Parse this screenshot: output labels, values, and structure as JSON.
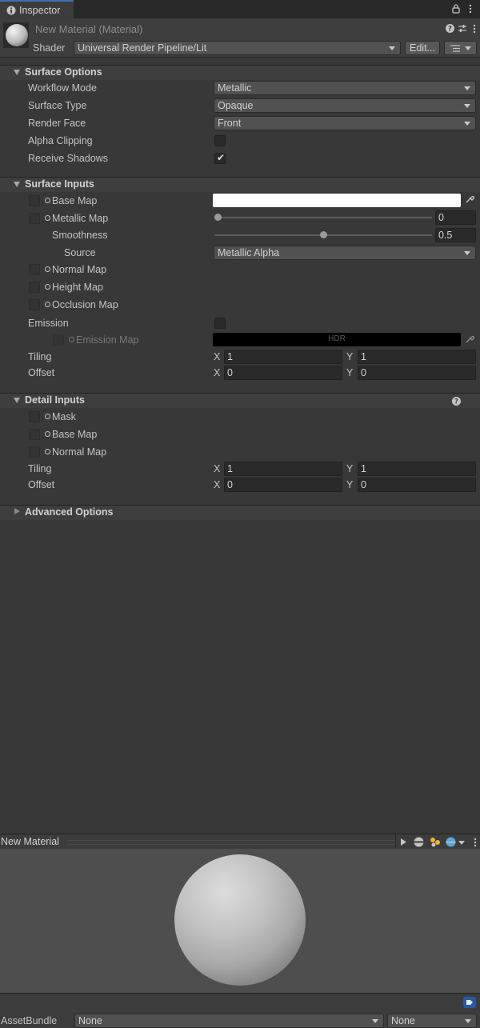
{
  "tab": {
    "title": "Inspector",
    "icon": "info-icon"
  },
  "header": {
    "title": "New Material (Material)",
    "shader_label": "Shader",
    "shader_value": "Universal Render Pipeline/Lit",
    "edit_button": "Edit..."
  },
  "surface_options": {
    "title": "Surface Options",
    "workflow_label": "Workflow Mode",
    "workflow_value": "Metallic",
    "surface_type_label": "Surface Type",
    "surface_type_value": "Opaque",
    "render_face_label": "Render Face",
    "render_face_value": "Front",
    "alpha_clipping_label": "Alpha Clipping",
    "alpha_clipping": false,
    "receive_shadows_label": "Receive Shadows",
    "receive_shadows": true
  },
  "surface_inputs": {
    "title": "Surface Inputs",
    "base_map_label": "Base Map",
    "base_map_color": "#ffffff",
    "metallic_map_label": "Metallic Map",
    "metallic_value": "0",
    "metallic": 0,
    "smoothness_label": "Smoothness",
    "smoothness_value": "0.5",
    "smoothness": 0.5,
    "source_label": "Source",
    "source_value": "Metallic Alpha",
    "normal_map_label": "Normal Map",
    "height_map_label": "Height Map",
    "occlusion_map_label": "Occlusion Map",
    "emission_label": "Emission",
    "emission_map_label": "Emission Map",
    "emission_hdr": "HDR",
    "tiling_label": "Tiling",
    "tiling_x": "1",
    "tiling_y": "1",
    "offset_label": "Offset",
    "offset_x": "0",
    "offset_y": "0",
    "x_label": "X",
    "y_label": "Y"
  },
  "detail_inputs": {
    "title": "Detail Inputs",
    "mask_label": "Mask",
    "base_map_label": "Base Map",
    "normal_map_label": "Normal Map",
    "tiling_label": "Tiling",
    "tiling_x": "1",
    "tiling_y": "1",
    "offset_label": "Offset",
    "offset_x": "0",
    "offset_y": "0",
    "x_label": "X",
    "y_label": "Y"
  },
  "advanced_options": {
    "title": "Advanced Options"
  },
  "preview": {
    "title": "New Material"
  },
  "asset_bundle": {
    "label": "AssetBundle",
    "name_value": "None",
    "variant_value": "None"
  }
}
